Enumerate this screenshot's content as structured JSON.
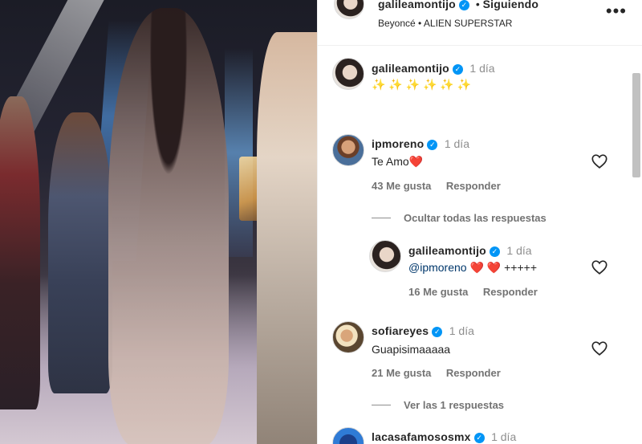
{
  "post": {
    "author": "galileamontijo",
    "follow_status": "Siguiendo",
    "audio": "Beyoncé • ALIEN SUPERSTAR"
  },
  "caption": {
    "author": "galileamontijo",
    "time": "1 día",
    "text": "✨ ✨ ✨ ✨ ✨ ✨"
  },
  "comments": [
    {
      "author": "ipmoreno",
      "time": "1 día",
      "text": "Te Amo",
      "emoji": "❤️",
      "likes": "43 Me gusta",
      "reply_label": "Responder",
      "replies_toggle": "Ocultar todas las respuestas",
      "replies": [
        {
          "author": "galileamontijo",
          "time": "1 día",
          "mention": "@ipmoreno",
          "emoji": "❤️ ❤️",
          "suffix": "+++++",
          "likes": "16 Me gusta",
          "reply_label": "Responder"
        }
      ]
    },
    {
      "author": "sofiareyes",
      "time": "1 día",
      "text": "Guapisimaaaaa",
      "likes": "21 Me gusta",
      "reply_label": "Responder",
      "replies_toggle": "Ver las 1 respuestas"
    },
    {
      "author": "lacasafamososmx",
      "time": "1 día"
    }
  ],
  "colors": {
    "verified": "#0095f6",
    "heart": "#ed4956",
    "muted": "#8e8e8e"
  }
}
